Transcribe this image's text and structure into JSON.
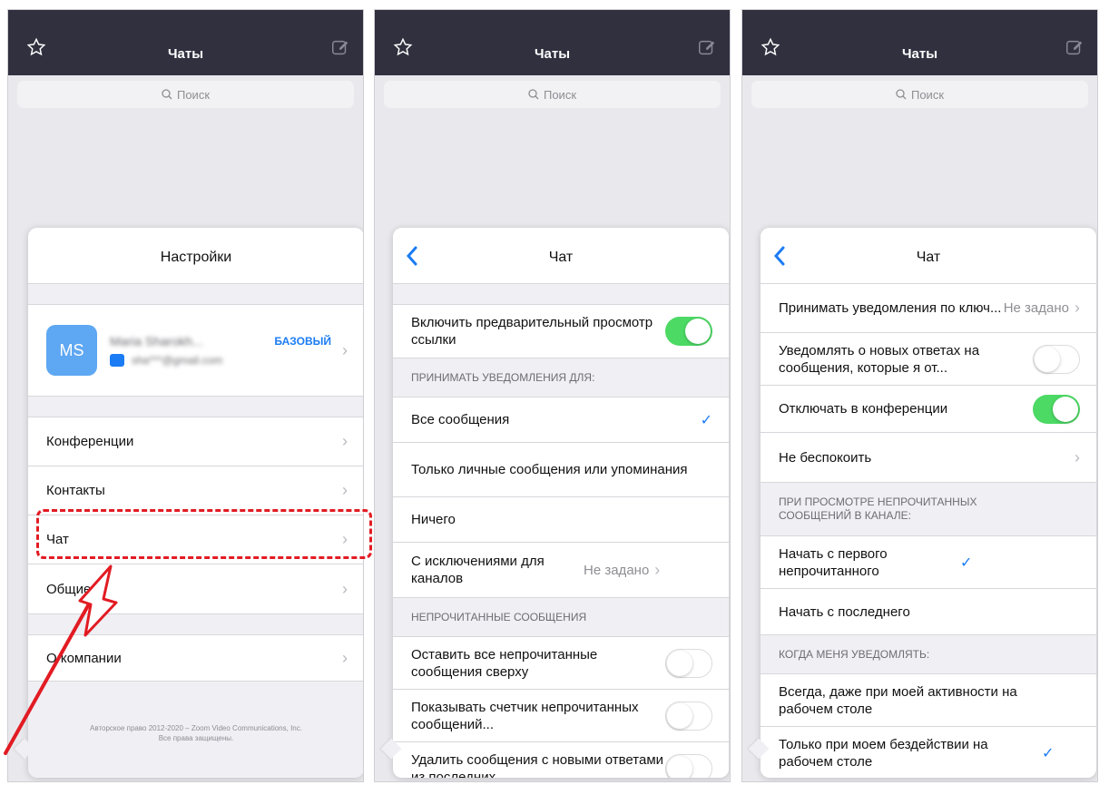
{
  "header": {
    "title": "Чаты"
  },
  "search": {
    "placeholder": "Поиск"
  },
  "settings": {
    "title": "Настройки",
    "profile": {
      "initials": "MS",
      "name": "Maria Sharokh...",
      "email": "sha***@gmail.com",
      "plan": "БАЗОВЫЙ"
    },
    "items": [
      "Конференции",
      "Контакты",
      "Чат",
      "Общие"
    ],
    "about": "О компании",
    "copyright_line1": "Авторское право 2012-2020 – Zoom Video Communications, Inc.",
    "copyright_line2": "Все права защищены."
  },
  "chat1": {
    "title": "Чат",
    "link_preview": {
      "label": "Включить предварительный просмотр ссылки",
      "on": true
    },
    "section_notify": "ПРИНИМАТЬ УВЕДОМЛЕНИЯ ДЛЯ:",
    "notify_options": [
      "Все сообщения",
      "Только личные сообщения или упоминания",
      "Ничего"
    ],
    "notify_selected": "Все сообщения",
    "exceptions": {
      "label": "С исключениями для каналов",
      "value": "Не задано"
    },
    "section_unread": "НЕПРОЧИТАННЫЕ СООБЩЕНИЯ",
    "unread_rows": [
      {
        "label": "Оставить все непрочитанные сообщения сверху",
        "on": false
      },
      {
        "label": "Показывать счетчик непрочитанных сообщений...",
        "on": false
      },
      {
        "label": "Удалить сообщения с новыми ответами из последних",
        "on": false
      }
    ]
  },
  "chat2": {
    "title": "Чат",
    "keywords": {
      "label": "Принимать уведомления по ключ...",
      "value": "Не задано"
    },
    "reply_notify": {
      "label": "Уведомлять о новых ответах на сообщения, которые я от...",
      "on": false
    },
    "mute_in_meeting": {
      "label": "Отключать в конференции",
      "on": true
    },
    "dnd": "Не беспокоить",
    "section_channel": "ПРИ ПРОСМОТРЕ НЕПРОЧИТАННЫХ СООБЩЕНИЙ В КАНАЛЕ:",
    "channel_options": [
      "Начать с первого непрочитанного",
      "Начать с последнего"
    ],
    "channel_selected": "Начать с первого непрочитанного",
    "section_when": "КОГДА МЕНЯ УВЕДОМЛЯТЬ:",
    "when_options": [
      "Всегда, даже при моей активности на рабочем столе",
      "Только при моем бездействии на рабочем столе"
    ],
    "when_selected": "Только при моем бездействии на рабочем столе"
  },
  "colors": {
    "toggle_on": "#4cd964",
    "accent": "#1b7cf4",
    "highlight": "#e21b23",
    "topbar": "#30303f"
  }
}
